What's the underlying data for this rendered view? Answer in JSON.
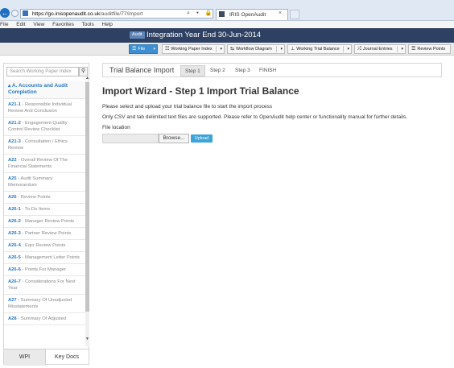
{
  "browser": {
    "url_host": "https://go.inisopenaudit.co.uk",
    "url_path": "/auditfile/77/import",
    "addr_controls": "⌕ ▾ 🔒 C",
    "tab_title": "IRIS OpenAudit",
    "tab_close": "×",
    "menu": [
      "File",
      "Edit",
      "View",
      "Favorites",
      "Tools",
      "Help"
    ]
  },
  "header": {
    "badge": "Audit",
    "title": "Integration Year End 30-Jun-2014"
  },
  "toolbar": {
    "file": "File",
    "working_paper_index": "Working Paper Index",
    "workflow_diagram": "Workflow Diagram",
    "working_trial_balance": "Working Trial Balance",
    "journal_entries": "Journal Entries",
    "review_points": "Review Points"
  },
  "sidebar": {
    "search_placeholder": "Search Working Paper Index",
    "section_title": "A. Accounts and Audit Completion",
    "items": [
      {
        "code": "A21-1",
        "label": "Responsible Individual Review And Conclusion"
      },
      {
        "code": "A21-2",
        "label": "Engagement Quality Control Review Checklist"
      },
      {
        "code": "A21-3",
        "label": "Consultation / Ethics Review"
      },
      {
        "code": "A22",
        "label": "Overall Review Of The Financial Statements"
      },
      {
        "code": "A25",
        "label": "Audit Summary Memorandum"
      },
      {
        "code": "A26",
        "label": "Review Points"
      },
      {
        "code": "A26-1",
        "label": "To-Do Items"
      },
      {
        "code": "A26-2",
        "label": "Manager Review Points"
      },
      {
        "code": "A26-3",
        "label": "Partner Review Points"
      },
      {
        "code": "A26-4",
        "label": "Eqcr Review Points"
      },
      {
        "code": "A26-5",
        "label": "Management Letter Points"
      },
      {
        "code": "A26-6",
        "label": "Points For Manager"
      },
      {
        "code": "A26-7",
        "label": "Considerations For Next Year"
      },
      {
        "code": "A27",
        "label": "Summary Of Unadjusted Misstatements"
      },
      {
        "code": "A28",
        "label": "Summary Of Adjusted"
      }
    ],
    "tab_wpi": "WPI",
    "tab_key_docs": "Key Docs"
  },
  "wizard": {
    "title": "Trial Balance Import",
    "steps": [
      "Step 1",
      "Step 2",
      "Step 3",
      "FINISH"
    ],
    "heading": "Import Wizard - Step 1 Import Trial Balance",
    "para1": "Please select and upload your trial balance file to start the import process",
    "para2": "Only CSV and tab delimited text files are supported. Please refer to OpenAudit help center or functionality manual for further details.",
    "file_location_label": "File location",
    "browse_label": "Browse...",
    "upload_label": "Upload"
  }
}
